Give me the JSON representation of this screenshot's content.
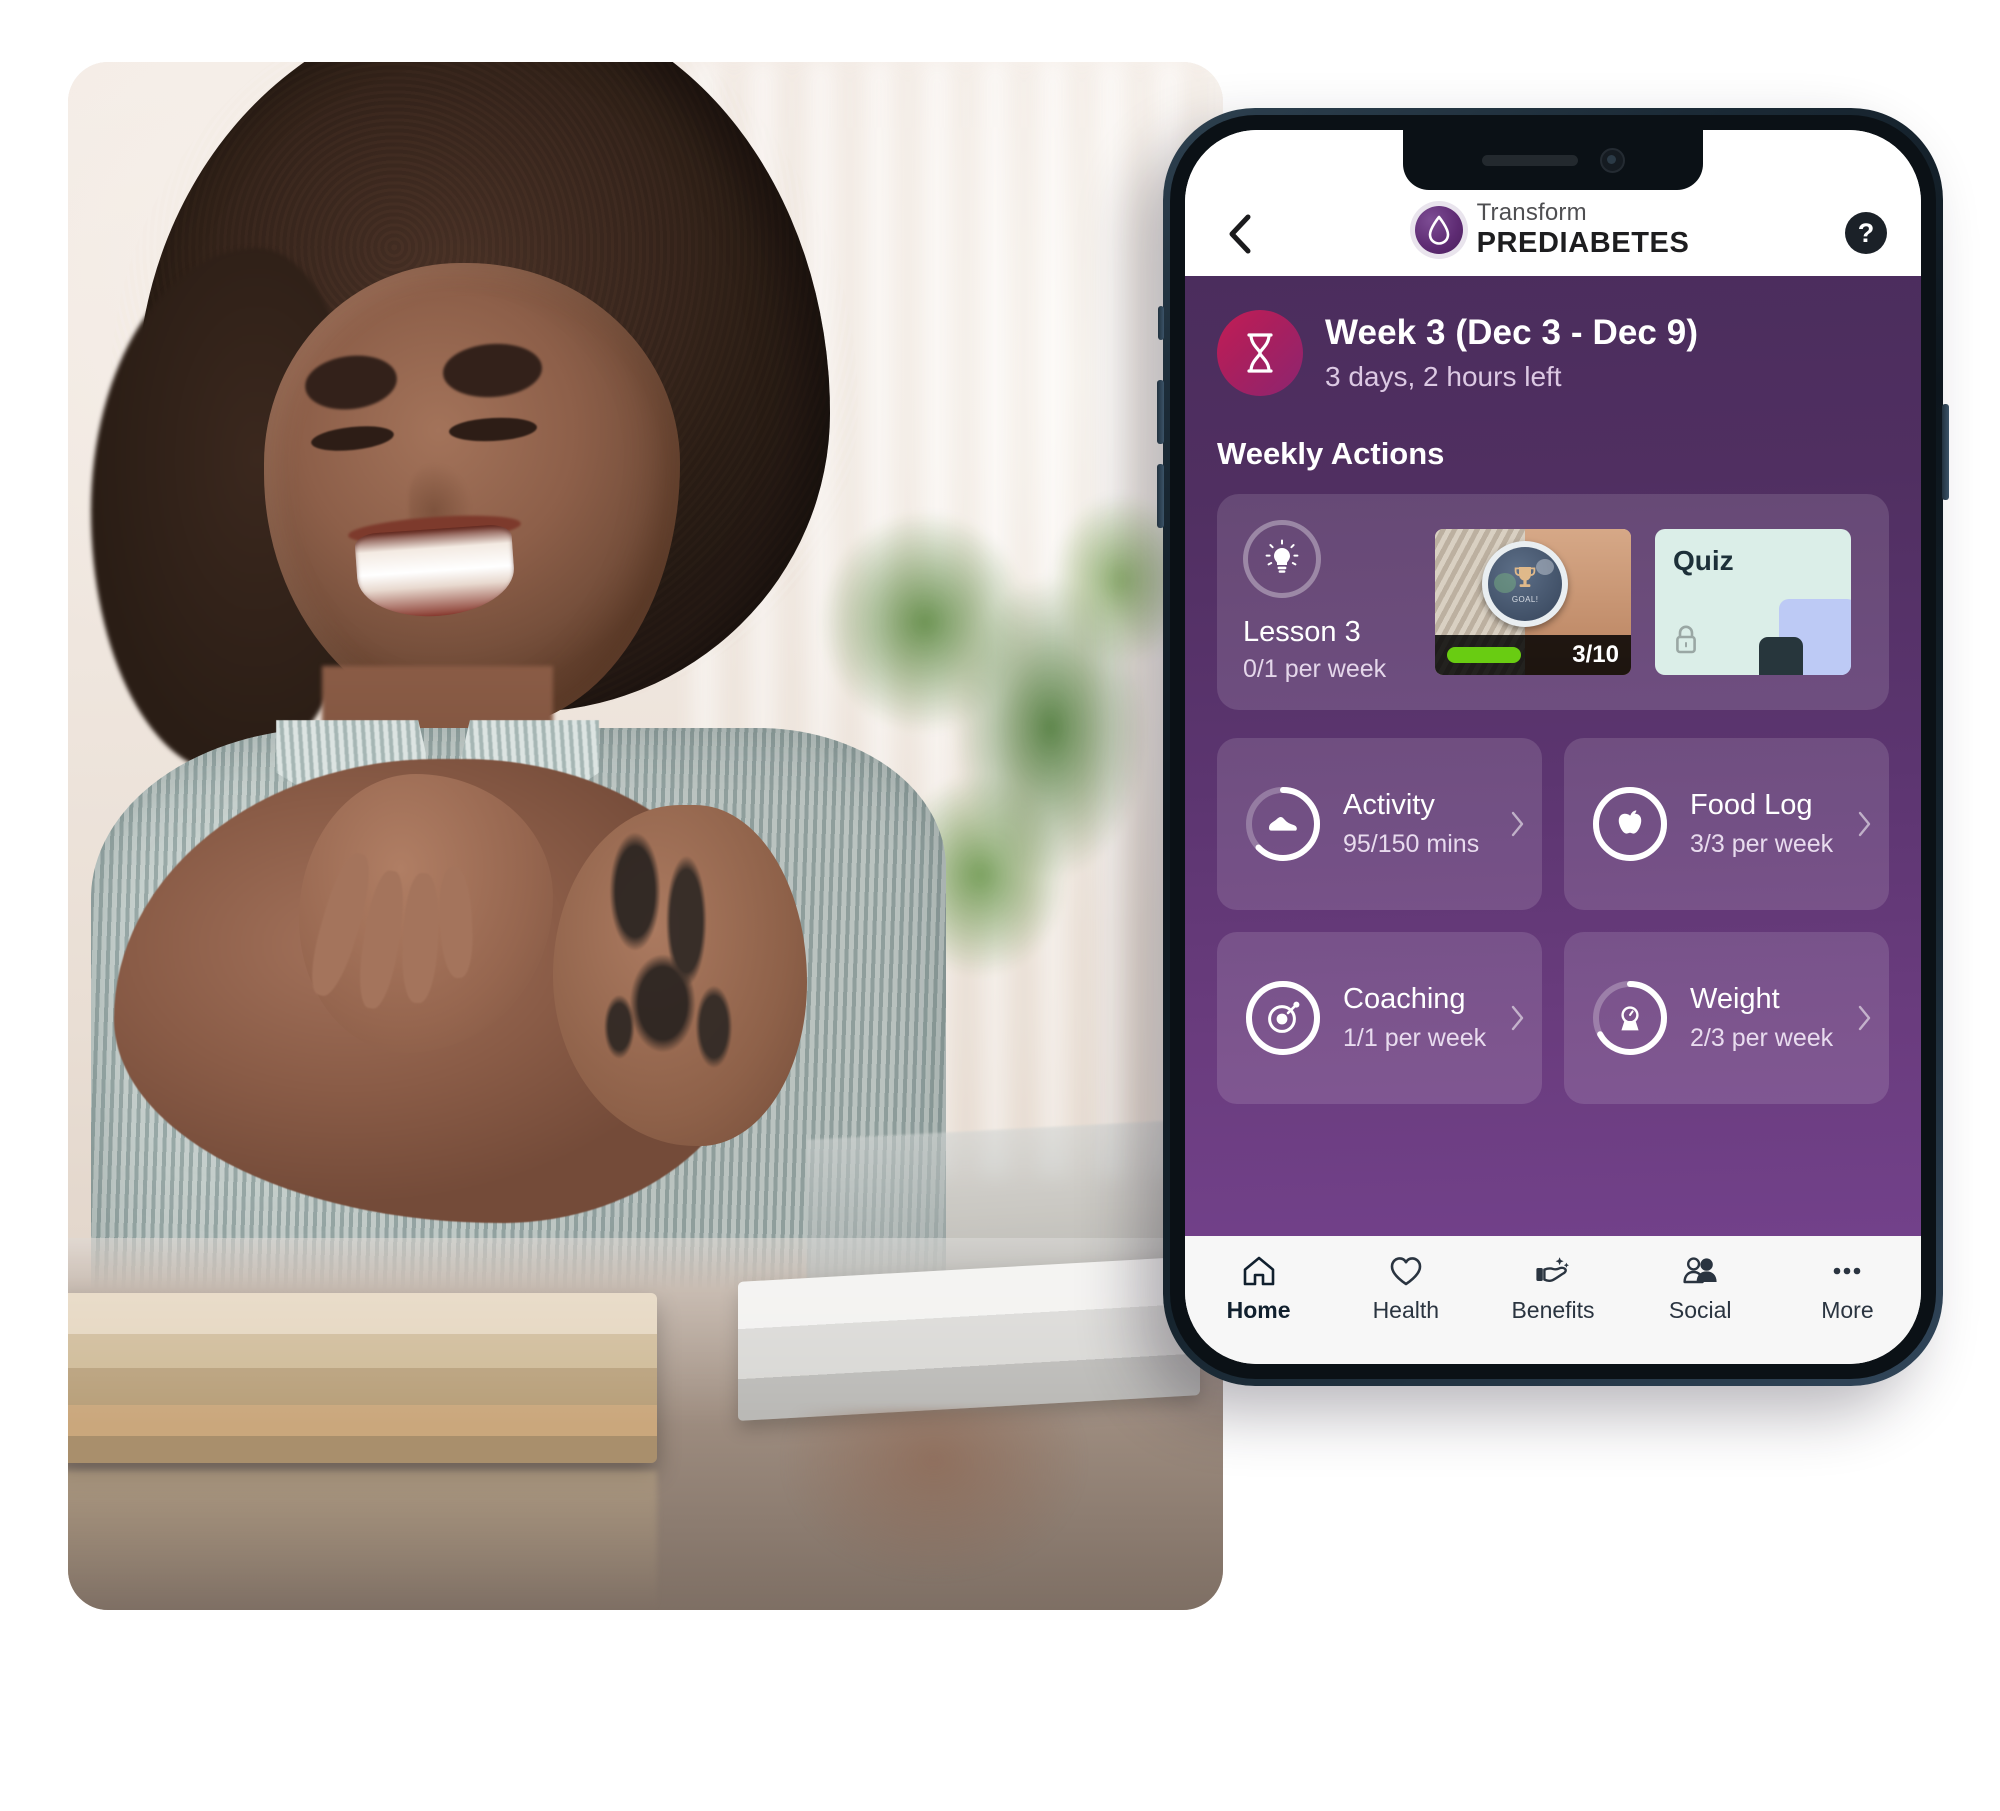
{
  "app": {
    "header": {
      "back_icon": "chevron-left-icon",
      "brand_top": "Transform",
      "brand_bottom": "PREDIABETES",
      "brand_icon": "water-drop-icon",
      "help_label": "?"
    },
    "week_banner": {
      "icon": "hourglass-icon",
      "title": "Week 3 (Dec 3 - Dec 9)",
      "subtitle": "3 days, 2 hours left"
    },
    "section_title": "Weekly Actions",
    "lesson_card": {
      "icon": "lightbulb-icon",
      "title": "Lesson 3",
      "meta": "0/1 per week",
      "thumbnail": {
        "name": "smartwatch-goal-thumbnail",
        "watch_label": "GOAL!",
        "watch_icon": "trophy-icon",
        "progress_text": "3/10",
        "progress_color": "#69cc12"
      },
      "quiz": {
        "label": "Quiz",
        "locked_icon": "lock-icon",
        "background": "#dbeee8"
      }
    },
    "metrics": [
      {
        "name": "Activity",
        "value": "95/150 mins",
        "icon": "shoe-icon",
        "ring_percent": 63,
        "chevron": "chevron-right-icon"
      },
      {
        "name": "Food Log",
        "value": "3/3 per week",
        "icon": "apple-icon",
        "ring_percent": 100,
        "chevron": "chevron-right-icon"
      },
      {
        "name": "Coaching",
        "value": "1/1 per week",
        "icon": "target-icon",
        "ring_percent": 100,
        "chevron": "chevron-right-icon"
      },
      {
        "name": "Weight",
        "value": "2/3 per week",
        "icon": "scale-icon",
        "ring_percent": 67,
        "chevron": "chevron-right-icon"
      }
    ],
    "tabbar": [
      {
        "label": "Home",
        "icon": "house-icon",
        "active": true
      },
      {
        "label": "Health",
        "icon": "heart-icon",
        "active": false
      },
      {
        "label": "Benefits",
        "icon": "hand-sparkle-icon",
        "active": false
      },
      {
        "label": "Social",
        "icon": "people-icon",
        "active": false
      },
      {
        "label": "More",
        "icon": "ellipsis-icon",
        "active": false
      }
    ]
  },
  "colors": {
    "brand_purple": "#5c3570",
    "header_white": "#ffffff",
    "accent_magenta": "#b81e5a",
    "progress_green": "#69cc12",
    "quiz_mint": "#dbeee8",
    "card_overlay": "rgba(255,255,255,0.13)",
    "tabbar_bg": "#f7f7f7",
    "phone_frame": "#1b2a36"
  }
}
